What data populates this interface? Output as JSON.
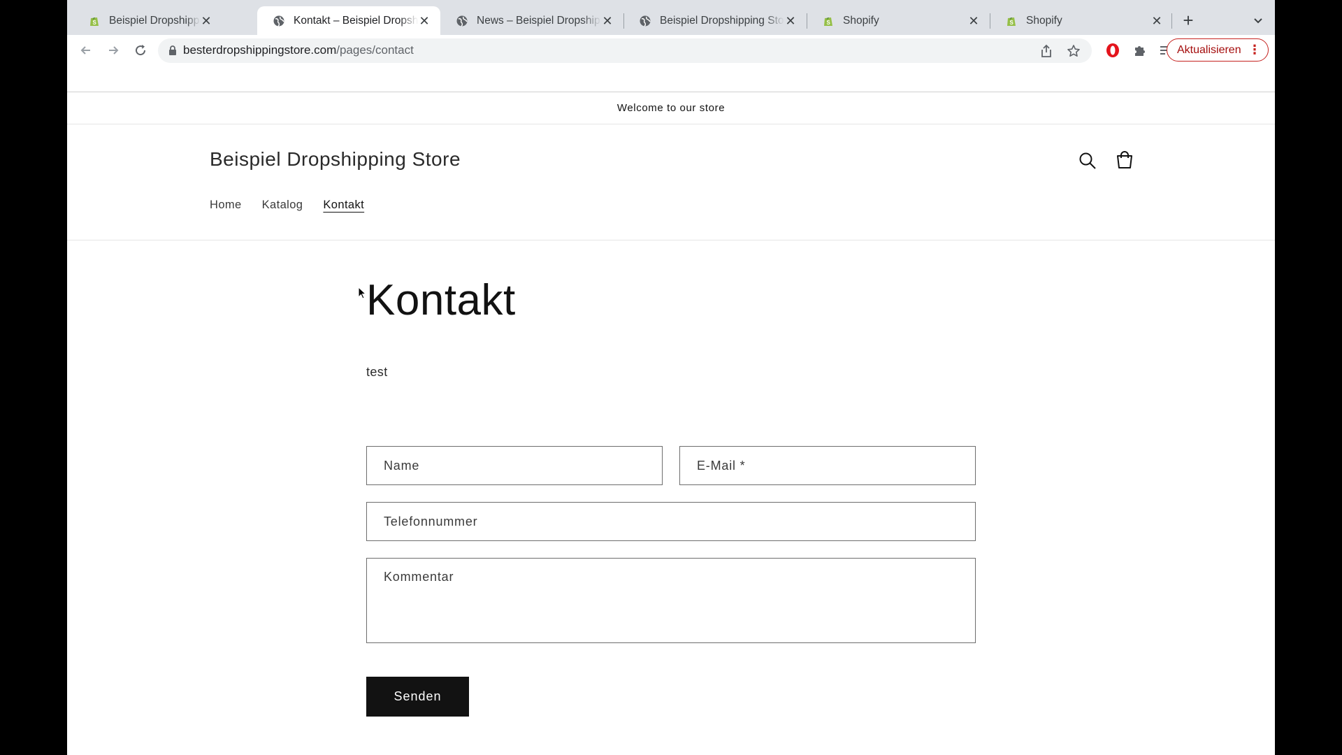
{
  "browser": {
    "tabs": [
      {
        "title": "Beispiel Dropshipping Store",
        "favicon": "shopify-icon",
        "active": false
      },
      {
        "title": "Kontakt – Beispiel Dropshipping Store",
        "favicon": "globe-icon",
        "active": true
      },
      {
        "title": "News – Beispiel Dropshipping Store",
        "favicon": "globe-icon",
        "active": false
      },
      {
        "title": "Beispiel Dropshipping Store",
        "favicon": "globe-icon",
        "active": false
      },
      {
        "title": "Shopify",
        "favicon": "shopify-icon",
        "active": false
      },
      {
        "title": "Shopify",
        "favicon": "shopify-icon",
        "active": false
      }
    ],
    "close_glyph": "✕",
    "new_tab_glyph": "+",
    "url_domain": "besterdropshippingstore.com",
    "url_path": "/pages/contact",
    "update_label": "Aktualisieren",
    "menu_glyph": "⋮",
    "colors": {
      "tab_strip": "#dee1e6",
      "omnibox": "#f1f3f4",
      "update_accent": "#c5221f"
    }
  },
  "store": {
    "announcement": "Welcome to our store",
    "name": "Beispiel Dropshipping Store",
    "nav": [
      {
        "label": "Home",
        "active": false
      },
      {
        "label": "Katalog",
        "active": false
      },
      {
        "label": "Kontakt",
        "active": true
      }
    ]
  },
  "page": {
    "title": "Kontakt",
    "text": "test"
  },
  "form": {
    "name_placeholder": "Name",
    "email_placeholder": "E-Mail *",
    "phone_placeholder": "Telefonnummer",
    "comment_placeholder": "Kommentar",
    "submit_label": "Senden",
    "button_color": "#121212"
  }
}
